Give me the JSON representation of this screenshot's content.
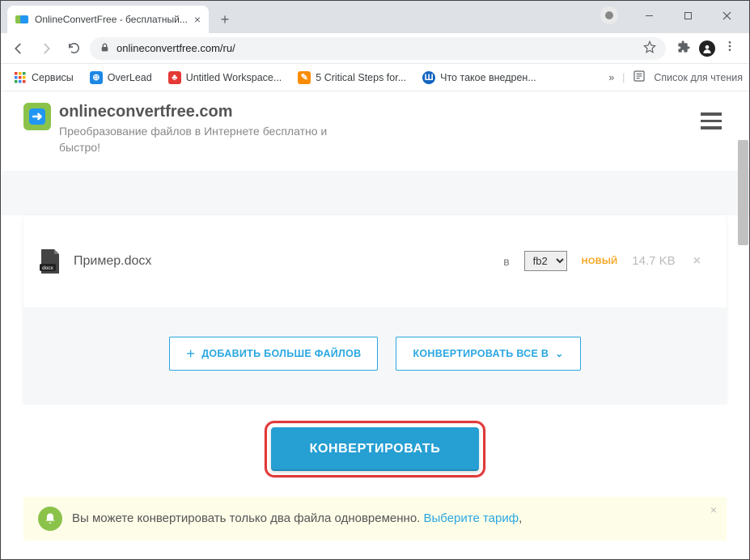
{
  "browser": {
    "tab_title": "OnlineConvertFree - бесплатный...",
    "url_display": "onlineconvertfree.com/ru/",
    "reading_list": "Список для чтения"
  },
  "bookmarks": {
    "services": "Сервисы",
    "items": [
      {
        "label": "OverLead",
        "color": "#1E88E5"
      },
      {
        "label": "Untitled Workspace...",
        "color": "#E53935"
      },
      {
        "label": "5 Critical Steps for...",
        "color": "#FB8C00"
      },
      {
        "label": "Что такое внедрен...",
        "color": "#1565C0"
      }
    ]
  },
  "site": {
    "name": "onlineconvertfree.com",
    "tagline": "Преобразование файлов в Интернете бесплатно и быстро!"
  },
  "file": {
    "name": "Пример.docx",
    "to_label": "в",
    "format": "fb2",
    "badge": "НОВЫЙ",
    "size": "14.7 KB"
  },
  "actions": {
    "add_more": "ДОБАВИТЬ БОЛЬШЕ ФАЙЛОВ",
    "convert_all": "КОНВЕРТИРОВАТЬ ВСЕ В",
    "convert": "КОНВЕРТИРОВАТЬ"
  },
  "notice": {
    "text": "Вы можете конвертировать только два файла одновременно. ",
    "link": "Выберите тариф"
  }
}
